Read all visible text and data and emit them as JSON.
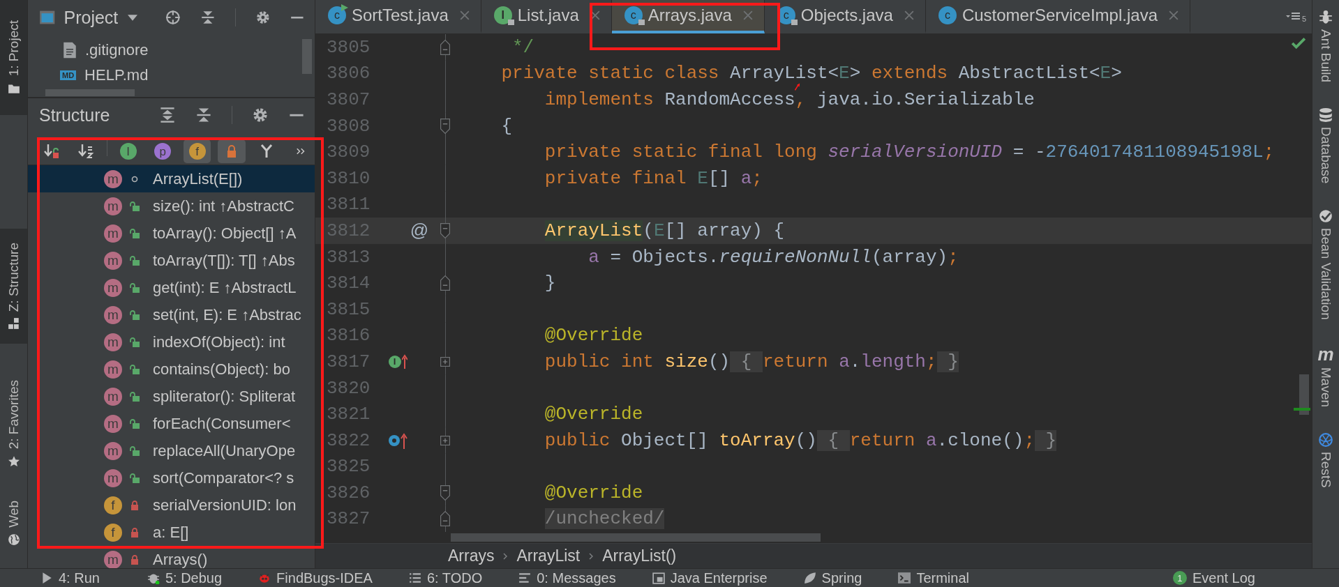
{
  "left_strip": [
    {
      "label": "1: Project",
      "selected": true
    },
    {
      "label": "Z: Structure",
      "selected": true
    },
    {
      "label": "2: Favorites",
      "selected": false
    },
    {
      "label": "Web",
      "selected": false
    }
  ],
  "project_panel": {
    "title": "Project",
    "files": [
      {
        "name": ".gitignore",
        "kind": "text"
      },
      {
        "name": "HELP.md",
        "kind": "markdown",
        "icon_text": "MD"
      }
    ]
  },
  "structure_panel": {
    "title": "Structure",
    "toolbar": [
      {
        "kind": "visibility",
        "on": false
      },
      {
        "kind": "alphabetical",
        "on": false
      },
      {
        "kind": "inherited",
        "icon_text": "I",
        "on": false
      },
      {
        "kind": "properties",
        "icon_text": "p",
        "on": false
      },
      {
        "kind": "fields",
        "icon_text": "f",
        "on": true
      },
      {
        "kind": "nonpublic",
        "on": true
      },
      {
        "kind": "lambdas",
        "on": false
      },
      {
        "kind": "more",
        "on": false
      }
    ],
    "items": [
      {
        "label": "ArrayList(E[])",
        "icon_text": "m",
        "kind": "constructor",
        "private": false,
        "selected": true
      },
      {
        "label": "size(): int ↑AbstractC",
        "icon_text": "m",
        "kind": "method",
        "private": false,
        "selected": false
      },
      {
        "label": "toArray(): Object[] ↑A",
        "icon_text": "m",
        "kind": "method",
        "private": false,
        "selected": false
      },
      {
        "label": "toArray(T[]): T[] ↑Abs",
        "icon_text": "m",
        "kind": "method",
        "private": false,
        "selected": false
      },
      {
        "label": "get(int): E ↑AbstractL",
        "icon_text": "m",
        "kind": "method",
        "private": false,
        "selected": false
      },
      {
        "label": "set(int, E): E ↑Abstrac",
        "icon_text": "m",
        "kind": "method",
        "private": false,
        "selected": false
      },
      {
        "label": "indexOf(Object): int",
        "icon_text": "m",
        "kind": "method",
        "private": false,
        "selected": false
      },
      {
        "label": "contains(Object): bo",
        "icon_text": "m",
        "kind": "method",
        "private": false,
        "selected": false
      },
      {
        "label": "spliterator(): Spliterat",
        "icon_text": "m",
        "kind": "method",
        "private": false,
        "selected": false
      },
      {
        "label": "forEach(Consumer<",
        "icon_text": "m",
        "kind": "method",
        "private": false,
        "selected": false
      },
      {
        "label": "replaceAll(UnaryOpe",
        "icon_text": "m",
        "kind": "method",
        "private": false,
        "selected": false
      },
      {
        "label": "sort(Comparator<? s",
        "icon_text": "m",
        "kind": "method",
        "private": false,
        "selected": false
      },
      {
        "label": "serialVersionUID: lon",
        "icon_text": "f",
        "kind": "field",
        "private": true,
        "selected": false
      },
      {
        "label": "a: E[]",
        "icon_text": "f",
        "kind": "field",
        "private": true,
        "selected": false
      },
      {
        "label": "Arrays()",
        "icon_text": "m",
        "kind": "constructor",
        "private": true,
        "selected": false
      }
    ]
  },
  "editor": {
    "tabs": [
      {
        "label": "SortTest.java",
        "icon_text": "c",
        "kind": "class",
        "runnable": true,
        "read_only": false,
        "selected": false
      },
      {
        "label": "List.java",
        "icon_text": "I",
        "kind": "interface",
        "runnable": false,
        "read_only": true,
        "selected": false
      },
      {
        "label": "Arrays.java",
        "icon_text": "c",
        "kind": "class",
        "runnable": false,
        "read_only": true,
        "selected": true
      },
      {
        "label": "Objects.java",
        "icon_text": "c",
        "kind": "class",
        "runnable": false,
        "read_only": true,
        "selected": false
      },
      {
        "label": "CustomerServiceImpl.java",
        "icon_text": "c",
        "kind": "class",
        "runnable": false,
        "read_only": false,
        "selected": false
      }
    ],
    "tab_overflow_count": "5",
    "lines": [
      {
        "number": "3805",
        "fold": {
          "kind": "end"
        },
        "current": false,
        "tokens": [
          {
            "t": "     */",
            "kind": "comment"
          }
        ]
      },
      {
        "number": "3806",
        "current": false,
        "tokens": [
          {
            "t": "    private static class ",
            "kind": "keyword"
          },
          {
            "t": "ArrayList<",
            "kind": "plain"
          },
          {
            "t": "E",
            "kind": "tparam"
          },
          {
            "t": "> ",
            "kind": "plain"
          },
          {
            "t": "extends ",
            "kind": "keyword"
          },
          {
            "t": "AbstractList<",
            "kind": "plain"
          },
          {
            "t": "E",
            "kind": "tparam"
          },
          {
            "t": ">",
            "kind": "plain"
          }
        ]
      },
      {
        "number": "3807",
        "current": false,
        "tokens": [
          {
            "t": "        implements ",
            "kind": "keyword"
          },
          {
            "t": "RandomAccess",
            "kind": "plain"
          },
          {
            "t": ", ",
            "kind": "keyword"
          },
          {
            "t": "java.io.Serializable",
            "kind": "plain"
          }
        ]
      },
      {
        "number": "3808",
        "fold": {
          "kind": "start"
        },
        "current": false,
        "tokens": [
          {
            "t": "    {",
            "kind": "plain"
          }
        ]
      },
      {
        "number": "3809",
        "current": false,
        "tokens": [
          {
            "t": "        private static final long ",
            "kind": "keyword"
          },
          {
            "t": "serialVersionUID",
            "kind": "constant"
          },
          {
            "t": " = -",
            "kind": "plain"
          },
          {
            "t": "2764017481108945198L",
            "kind": "number"
          },
          {
            "t": ";",
            "kind": "keyword"
          }
        ]
      },
      {
        "number": "3810",
        "current": false,
        "tokens": [
          {
            "t": "        private final ",
            "kind": "keyword"
          },
          {
            "t": "E",
            "kind": "tparam"
          },
          {
            "t": "[] ",
            "kind": "plain"
          },
          {
            "t": "a",
            "kind": "field"
          },
          {
            "t": ";",
            "kind": "keyword"
          }
        ]
      },
      {
        "number": "3811",
        "current": false
      },
      {
        "number": "3812",
        "fold": {
          "kind": "start"
        },
        "current": true,
        "marker": {
          "kind": "at",
          "text": "@"
        },
        "tokens": [
          {
            "t": "        ArrayList",
            "kind": "declaration"
          },
          {
            "t": "(",
            "kind": "plain"
          },
          {
            "t": "E",
            "kind": "tparam"
          },
          {
            "t": "[] array) {",
            "kind": "plain"
          }
        ]
      },
      {
        "number": "3813",
        "current": false,
        "tokens": [
          {
            "t": "            a",
            "kind": "field"
          },
          {
            "t": " = Objects.",
            "kind": "plain"
          },
          {
            "t": "requireNonNull",
            "kind": "italic"
          },
          {
            "t": "(array)",
            "kind": "plain"
          },
          {
            "t": ";",
            "kind": "keyword"
          }
        ]
      },
      {
        "number": "3814",
        "fold": {
          "kind": "end"
        },
        "current": false,
        "tokens": [
          {
            "t": "        }",
            "kind": "plain"
          }
        ]
      },
      {
        "number": "3815",
        "current": false
      },
      {
        "number": "3816",
        "current": false,
        "tokens": [
          {
            "t": "        @Override",
            "kind": "annotation"
          }
        ]
      },
      {
        "number": "3817",
        "fold": {
          "kind": "expand"
        },
        "current": false,
        "marker": {
          "kind": "implements",
          "text": "I"
        },
        "tokens": [
          {
            "t": "        public int ",
            "kind": "keyword"
          },
          {
            "t": "size",
            "kind": "method"
          },
          {
            "t": "()",
            "kind": "plain"
          },
          {
            "t": " { ",
            "kind": "folded"
          },
          {
            "t": "return ",
            "kind": "keyword"
          },
          {
            "t": "a",
            "kind": "field"
          },
          {
            "t": ".",
            "kind": "plain"
          },
          {
            "t": "length",
            "kind": "field"
          },
          {
            "t": ";",
            "kind": "keyword"
          },
          {
            "t": " }",
            "kind": "folded"
          }
        ]
      },
      {
        "number": "3820",
        "current": false
      },
      {
        "number": "3821",
        "current": false,
        "tokens": [
          {
            "t": "        @Override",
            "kind": "annotation"
          }
        ]
      },
      {
        "number": "3822",
        "fold": {
          "kind": "expand"
        },
        "current": false,
        "marker": {
          "kind": "overrides"
        },
        "tokens": [
          {
            "t": "        public ",
            "kind": "keyword"
          },
          {
            "t": "Object[] ",
            "kind": "plain"
          },
          {
            "t": "toArray",
            "kind": "method"
          },
          {
            "t": "()",
            "kind": "plain"
          },
          {
            "t": " { ",
            "kind": "folded"
          },
          {
            "t": "return ",
            "kind": "keyword"
          },
          {
            "t": "a",
            "kind": "field"
          },
          {
            "t": ".clone()",
            "kind": "plain"
          },
          {
            "t": ";",
            "kind": "keyword"
          },
          {
            "t": " }",
            "kind": "folded"
          }
        ]
      },
      {
        "number": "3825",
        "current": false
      },
      {
        "number": "3826",
        "fold": {
          "kind": "start"
        },
        "current": false,
        "tokens": [
          {
            "t": "        @Override",
            "kind": "annotation"
          }
        ]
      },
      {
        "number": "3827",
        "fold": {
          "kind": "end"
        },
        "current": false,
        "tokens": [
          {
            "t": "        /unchecked/",
            "kind": "foldedcomment"
          }
        ]
      }
    ],
    "breadcrumb": [
      "Arrays",
      "ArrayList",
      "ArrayList()"
    ]
  },
  "right_strip": [
    {
      "label": "Ant Build"
    },
    {
      "label": "Database"
    },
    {
      "label": "Bean Validation"
    },
    {
      "label": "Maven",
      "icon_text": "m"
    },
    {
      "label": "RestS"
    }
  ],
  "bottom_bar": [
    {
      "label": "4: Run"
    },
    {
      "label": "5: Debug"
    },
    {
      "label": "FindBugs-IDEA"
    },
    {
      "label": "6: TODO"
    },
    {
      "label": "0: Messages"
    },
    {
      "label": "Java Enterprise"
    },
    {
      "label": "Spring"
    },
    {
      "label": "Terminal"
    },
    {
      "label": "Event Log",
      "badge": "1"
    }
  ]
}
